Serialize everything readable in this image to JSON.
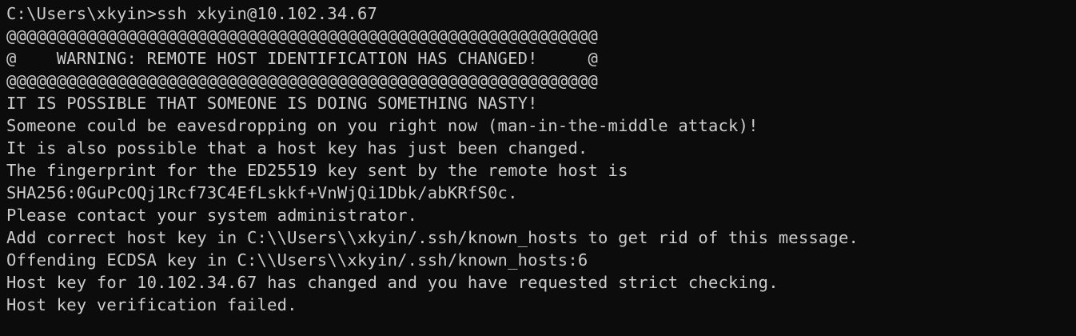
{
  "terminal": {
    "colors": {
      "background": "#0c0c0c",
      "foreground": "#cccccc"
    },
    "lines": [
      "C:\\Users\\xkyin>ssh xkyin@10.102.34.67",
      "@@@@@@@@@@@@@@@@@@@@@@@@@@@@@@@@@@@@@@@@@@@@@@@@@@@@@@@@@@@",
      "@    WARNING: REMOTE HOST IDENTIFICATION HAS CHANGED!     @",
      "@@@@@@@@@@@@@@@@@@@@@@@@@@@@@@@@@@@@@@@@@@@@@@@@@@@@@@@@@@@",
      "IT IS POSSIBLE THAT SOMEONE IS DOING SOMETHING NASTY!",
      "Someone could be eavesdropping on you right now (man-in-the-middle attack)!",
      "It is also possible that a host key has just been changed.",
      "The fingerprint for the ED25519 key sent by the remote host is",
      "SHA256:0GuPcOQj1Rcf73C4EfLskkf+VnWjQi1Dbk/abKRfS0c.",
      "Please contact your system administrator.",
      "Add correct host key in C:\\\\Users\\\\xkyin/.ssh/known_hosts to get rid of this message.",
      "Offending ECDSA key in C:\\\\Users\\\\xkyin/.ssh/known_hosts:6",
      "Host key for 10.102.34.67 has changed and you have requested strict checking.",
      "Host key verification failed."
    ]
  }
}
